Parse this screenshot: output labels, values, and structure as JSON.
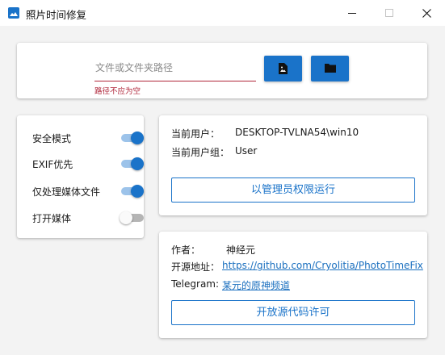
{
  "window": {
    "title": "照片时间修复",
    "icon": "app-photo-icon"
  },
  "path_section": {
    "placeholder": "文件或文件夹路径",
    "value": "",
    "error": "路径不应为空",
    "file_button_icon": "file-image-icon",
    "folder_button_icon": "folder-icon"
  },
  "options": [
    {
      "label": "安全模式",
      "on": true
    },
    {
      "label": "EXIF优先",
      "on": true
    },
    {
      "label": "仅处理媒体文件",
      "on": true
    },
    {
      "label": "打开媒体",
      "on": false
    }
  ],
  "user": {
    "current_user_label": "当前用户：",
    "current_user_value": "DESKTOP-TVLNA54\\win10",
    "group_label": "当前用户组：",
    "group_value": "User",
    "run_as_admin": "以管理员权限运行"
  },
  "about": {
    "author_label": "作者：",
    "author_value": "神经元",
    "source_label": "开源地址：",
    "source_link": "https://github.com/Cryolitia/PhotoTimeFix",
    "telegram_label": "Telegram:",
    "telegram_link": "某元的原神频道",
    "license_button": "开放源代码许可"
  },
  "colors": {
    "accent": "#1a73c9",
    "error": "#b0263a",
    "background": "#f3f3f3"
  }
}
